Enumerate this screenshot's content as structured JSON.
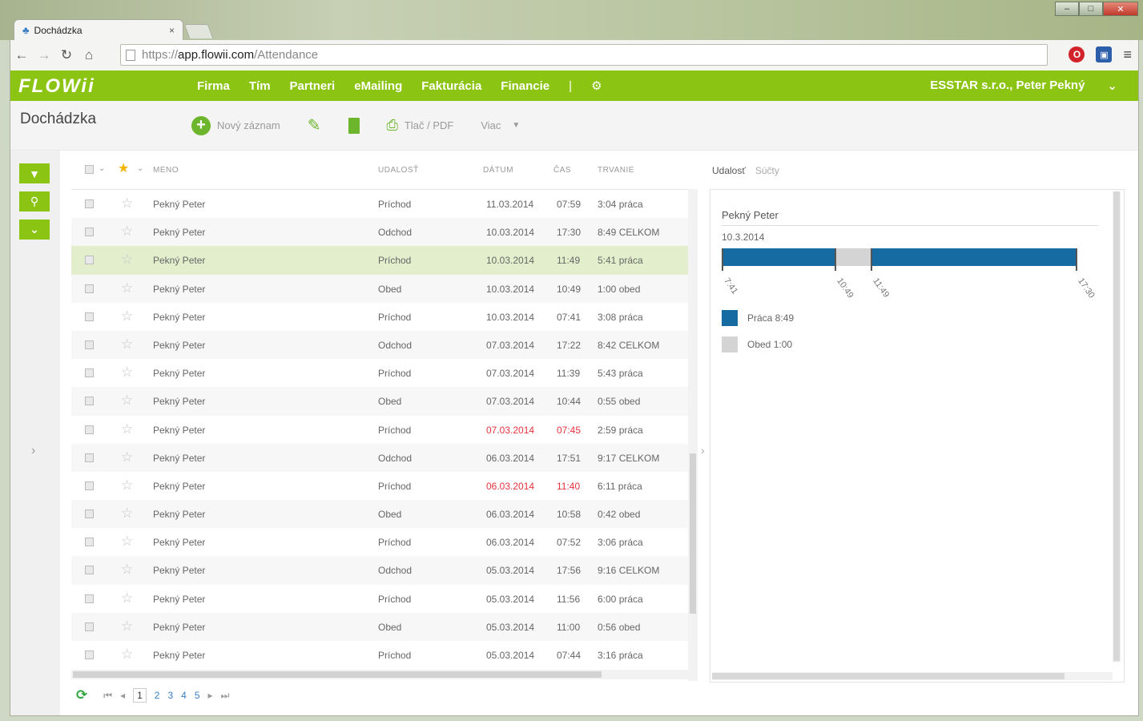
{
  "browser": {
    "tab_title": "Dochádzka",
    "tab_close": "×",
    "url_prefix": "https://",
    "url_host": "app.flowii.com",
    "url_path": "/Attendance"
  },
  "app": {
    "logo": "FLOWii",
    "nav": [
      "Firma",
      "Tím",
      "Partneri",
      "eMailing",
      "Fakturácia",
      "Financie"
    ],
    "nav_sep": "|",
    "user": "ESSTAR s.r.o., Peter Pekný",
    "page_title": "Dochádzka",
    "actions": {
      "new_record": "Nový záznam",
      "print": "Tlač / PDF",
      "more": "Viac"
    }
  },
  "list": {
    "headers": {
      "name": "MENO",
      "event": "UDALOSŤ",
      "date": "DÁTUM",
      "time": "ČAS",
      "duration": "TRVANIE"
    },
    "rows": [
      {
        "name": "Pekný Peter",
        "event": "Príchod",
        "date": "11.03.2014",
        "time": "07:59",
        "duration": "3:04 práca"
      },
      {
        "name": "Pekný Peter",
        "event": "Odchod",
        "date": "10.03.2014",
        "time": "17:30",
        "duration": "8:49 CELKOM"
      },
      {
        "name": "Pekný Peter",
        "event": "Príchod",
        "date": "10.03.2014",
        "time": "11:49",
        "duration": "5:41 práca"
      },
      {
        "name": "Pekný Peter",
        "event": "Obed",
        "date": "10.03.2014",
        "time": "10:49",
        "duration": "1:00 obed"
      },
      {
        "name": "Pekný Peter",
        "event": "Príchod",
        "date": "10.03.2014",
        "time": "07:41",
        "duration": "3:08 práca"
      },
      {
        "name": "Pekný Peter",
        "event": "Odchod",
        "date": "07.03.2014",
        "time": "17:22",
        "duration": "8:42 CELKOM"
      },
      {
        "name": "Pekný Peter",
        "event": "Príchod",
        "date": "07.03.2014",
        "time": "11:39",
        "duration": "5:43 práca"
      },
      {
        "name": "Pekný Peter",
        "event": "Obed",
        "date": "07.03.2014",
        "time": "10:44",
        "duration": "0:55 obed"
      },
      {
        "name": "Pekný Peter",
        "event": "Príchod",
        "date": "07.03.2014",
        "time": "07:45",
        "duration": "2:59 práca"
      },
      {
        "name": "Pekný Peter",
        "event": "Odchod",
        "date": "06.03.2014",
        "time": "17:51",
        "duration": "9:17 CELKOM"
      },
      {
        "name": "Pekný Peter",
        "event": "Príchod",
        "date": "06.03.2014",
        "time": "11:40",
        "duration": "6:11 práca"
      },
      {
        "name": "Pekný Peter",
        "event": "Obed",
        "date": "06.03.2014",
        "time": "10:58",
        "duration": "0:42 obed"
      },
      {
        "name": "Pekný Peter",
        "event": "Príchod",
        "date": "06.03.2014",
        "time": "07:52",
        "duration": "3:06 práca"
      },
      {
        "name": "Pekný Peter",
        "event": "Odchod",
        "date": "05.03.2014",
        "time": "17:56",
        "duration": "9:16 CELKOM"
      },
      {
        "name": "Pekný Peter",
        "event": "Príchod",
        "date": "05.03.2014",
        "time": "11:56",
        "duration": "6:00 práca"
      },
      {
        "name": "Pekný Peter",
        "event": "Obed",
        "date": "05.03.2014",
        "time": "11:00",
        "duration": "0:56 obed"
      },
      {
        "name": "Pekný Peter",
        "event": "Príchod",
        "date": "05.03.2014",
        "time": "07:44",
        "duration": "3:16 práca"
      }
    ],
    "pages": [
      "1",
      "2",
      "3",
      "4",
      "5"
    ]
  },
  "detail": {
    "tabs": [
      "Udalosť",
      "Súčty"
    ],
    "name": "Pekný Peter",
    "date": "10.3.2014",
    "tick_labels": [
      "7:41",
      "10:49",
      "11:49",
      "17:30"
    ],
    "legend": [
      {
        "label": "Práca 8:49",
        "color": "#176ba3"
      },
      {
        "label": "Obed 1:00",
        "color": "#d4d4d4"
      }
    ]
  }
}
